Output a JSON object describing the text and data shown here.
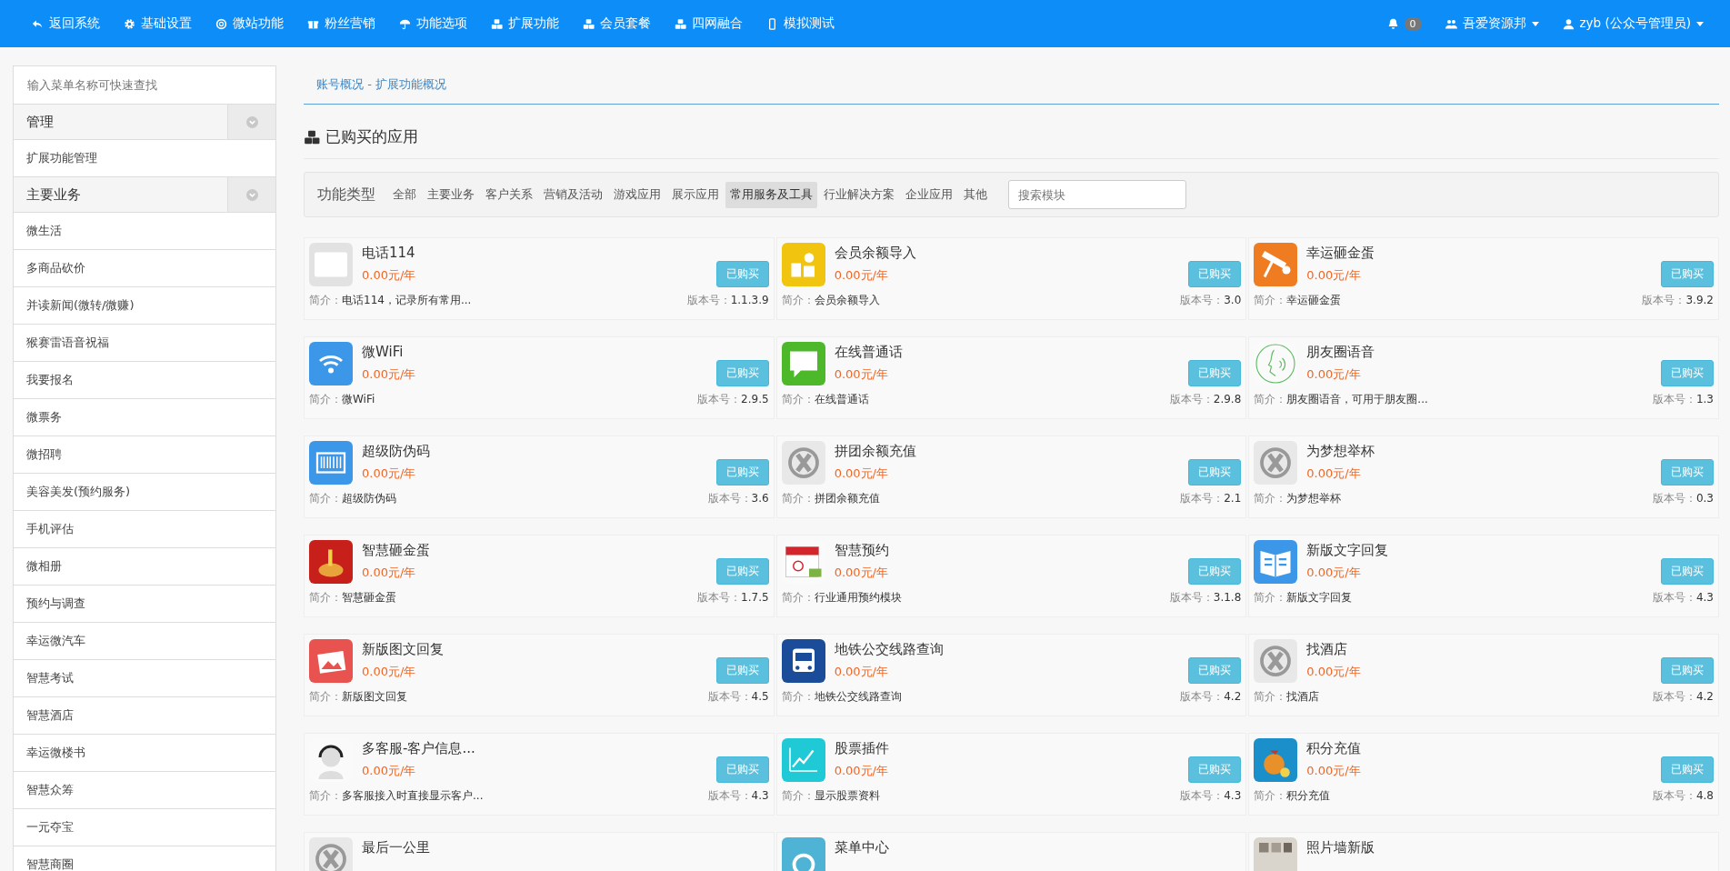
{
  "navbar": {
    "items": [
      {
        "label": "返回系统"
      },
      {
        "label": "基础设置"
      },
      {
        "label": "微站功能"
      },
      {
        "label": "粉丝营销"
      },
      {
        "label": "功能选项"
      },
      {
        "label": "扩展功能"
      },
      {
        "label": "会员套餐"
      },
      {
        "label": "四网融合"
      },
      {
        "label": "模拟测试"
      }
    ],
    "notifications": {
      "count": "0"
    },
    "account": {
      "label": "吾爱资源邦"
    },
    "user": {
      "label": "zyb (公众号管理员)"
    }
  },
  "sidebar": {
    "search": {
      "placeholder": "输入菜单名称可快速查找"
    },
    "groups": [
      {
        "title": "管理",
        "expanded": true,
        "items": [
          "扩展功能管理"
        ]
      },
      {
        "title": "主要业务",
        "expanded": true,
        "items": [
          "微生活",
          "多商品砍价",
          "并读新闻(微转/微赚)",
          "猴赛雷语音祝福",
          "我要报名",
          "微票务",
          "微招聘",
          "美容美发(预约服务)",
          "手机评估",
          "微相册",
          "预约与调查",
          "幸运微汽车",
          "智慧考试",
          "智慧酒店",
          "幸运微楼书",
          "智慧众筹",
          "一元夺宝",
          "智慧商圈"
        ]
      }
    ]
  },
  "breadcrumb": "账号概况 - 扩展功能概况",
  "section_title": "已购买的应用",
  "filter": {
    "label": "功能类型",
    "search_placeholder": "搜索模块",
    "categories": [
      {
        "label": "全部",
        "selected": false
      },
      {
        "label": "主要业务",
        "selected": false
      },
      {
        "label": "客户关系",
        "selected": false
      },
      {
        "label": "营销及活动",
        "selected": false
      },
      {
        "label": "游戏应用",
        "selected": false
      },
      {
        "label": "展示应用",
        "selected": false
      },
      {
        "label": "常用服务及工具",
        "selected": true
      },
      {
        "label": "行业解决方案",
        "selected": false
      },
      {
        "label": "企业应用",
        "selected": false
      },
      {
        "label": "其他",
        "selected": false
      }
    ]
  },
  "apps": [
    {
      "title": "电话114",
      "price": "0.00元/年",
      "button": "已购买",
      "intro_label": "简介：",
      "intro": "电话114，记录所有常用...",
      "version_label": "版本号：",
      "version": "1.1.3.9"
    },
    {
      "title": "会员余额导入",
      "price": "0.00元/年",
      "button": "已购买",
      "intro_label": "简介：",
      "intro": "会员余额导入",
      "version_label": "版本号：",
      "version": "3.0"
    },
    {
      "title": "幸运砸金蛋",
      "price": "0.00元/年",
      "button": "已购买",
      "intro_label": "简介：",
      "intro": "幸运砸金蛋",
      "version_label": "版本号：",
      "version": "3.9.2"
    },
    {
      "title": "微WiFi",
      "price": "0.00元/年",
      "button": "已购买",
      "intro_label": "简介：",
      "intro": "微WiFi",
      "version_label": "版本号：",
      "version": "2.9.5"
    },
    {
      "title": "在线普通话",
      "price": "0.00元/年",
      "button": "已购买",
      "intro_label": "简介：",
      "intro": "在线普通话",
      "version_label": "版本号：",
      "version": "2.9.8"
    },
    {
      "title": "朋友圈语音",
      "price": "0.00元/年",
      "button": "已购买",
      "intro_label": "简介：",
      "intro": "朋友圈语音，可用于朋友圈...",
      "version_label": "版本号：",
      "version": "1.3"
    },
    {
      "title": "超级防伪码",
      "price": "0.00元/年",
      "button": "已购买",
      "intro_label": "简介：",
      "intro": "超级防伪码",
      "version_label": "版本号：",
      "version": "3.6"
    },
    {
      "title": "拼团余额充值",
      "price": "0.00元/年",
      "button": "已购买",
      "intro_label": "简介：",
      "intro": "拼团余额充值",
      "version_label": "版本号：",
      "version": "2.1"
    },
    {
      "title": "为梦想举杯",
      "price": "0.00元/年",
      "button": "已购买",
      "intro_label": "简介：",
      "intro": "为梦想举杯",
      "version_label": "版本号：",
      "version": "0.3"
    },
    {
      "title": "智慧砸金蛋",
      "price": "0.00元/年",
      "button": "已购买",
      "intro_label": "简介：",
      "intro": "智慧砸金蛋",
      "version_label": "版本号：",
      "version": "1.7.5"
    },
    {
      "title": "智慧预约",
      "price": "0.00元/年",
      "button": "已购买",
      "intro_label": "简介：",
      "intro": "行业通用预约模块",
      "version_label": "版本号：",
      "version": "3.1.8"
    },
    {
      "title": "新版文字回复",
      "price": "0.00元/年",
      "button": "已购买",
      "intro_label": "简介：",
      "intro": "新版文字回复",
      "version_label": "版本号：",
      "version": "4.3"
    },
    {
      "title": "新版图文回复",
      "price": "0.00元/年",
      "button": "已购买",
      "intro_label": "简介：",
      "intro": "新版图文回复",
      "version_label": "版本号：",
      "version": "4.5"
    },
    {
      "title": "地铁公交线路查询",
      "price": "0.00元/年",
      "button": "已购买",
      "intro_label": "简介：",
      "intro": "地铁公交线路查询",
      "version_label": "版本号：",
      "version": "4.2"
    },
    {
      "title": "找酒店",
      "price": "0.00元/年",
      "button": "已购买",
      "intro_label": "简介：",
      "intro": "找酒店",
      "version_label": "版本号：",
      "version": "4.2"
    },
    {
      "title": "多客服-客户信息...",
      "price": "0.00元/年",
      "button": "已购买",
      "intro_label": "简介：",
      "intro": "多客服接入时直接显示客户...",
      "version_label": "版本号：",
      "version": "4.3"
    },
    {
      "title": "股票插件",
      "price": "0.00元/年",
      "button": "已购买",
      "intro_label": "简介：",
      "intro": "显示股票资料",
      "version_label": "版本号：",
      "version": "4.3"
    },
    {
      "title": "积分充值",
      "price": "0.00元/年",
      "button": "已购买",
      "intro_label": "简介：",
      "intro": "积分充值",
      "version_label": "版本号：",
      "version": "4.8"
    },
    {
      "title": "最后一公里"
    },
    {
      "title": "菜单中心"
    },
    {
      "title": "照片墙新版"
    }
  ]
}
